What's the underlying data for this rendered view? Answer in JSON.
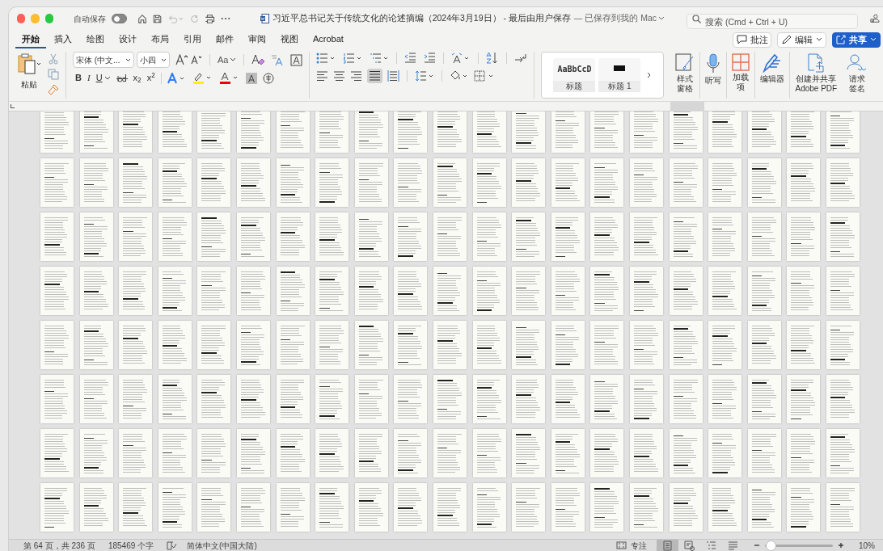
{
  "window": {
    "title": "习近平总书记关于传统文化的论述摘编（2024年3月19日） - 最后由用户保存",
    "save_status": "— 已保存到我的 Mac"
  },
  "autosave": {
    "label": "自动保存",
    "on": false
  },
  "search": {
    "placeholder": "搜索 (Cmd + Ctrl + U)"
  },
  "tabs": [
    {
      "label": "开始",
      "selected": true
    },
    {
      "label": "插入",
      "selected": false
    },
    {
      "label": "绘图",
      "selected": false
    },
    {
      "label": "设计",
      "selected": false
    },
    {
      "label": "布局",
      "selected": false
    },
    {
      "label": "引用",
      "selected": false
    },
    {
      "label": "邮件",
      "selected": false
    },
    {
      "label": "审阅",
      "selected": false
    },
    {
      "label": "视图",
      "selected": false
    },
    {
      "label": "Acrobat",
      "selected": false
    }
  ],
  "header_buttons": [
    {
      "label": "批注",
      "kind": "comment"
    },
    {
      "label": "编辑",
      "kind": "edit"
    },
    {
      "label": "共享",
      "kind": "share"
    }
  ],
  "clipboard": {
    "paste_label": "粘贴"
  },
  "font": {
    "name": "宋体 (中文...",
    "size": "小四",
    "case_label": "Aa"
  },
  "format_buttons": [
    {
      "label": "B",
      "kind": "bold"
    },
    {
      "label": "I",
      "kind": "italic"
    },
    {
      "label": "U",
      "kind": "underline"
    },
    {
      "label": "x$_{2}$",
      "kind": "plain"
    },
    {
      "label": "x$^{2}$",
      "kind": "plain"
    }
  ],
  "styles": [
    {
      "preview": "AaBbCcD",
      "label": "标题",
      "kind": "text"
    },
    {
      "label": "标题 1",
      "kind": "blob"
    }
  ],
  "large_buttons": [
    {
      "label": "样式窗格",
      "kind": "styles-pane"
    },
    {
      "label": "听写",
      "kind": "mic"
    },
    {
      "label": "加载项",
      "kind": "addins"
    },
    {
      "label": "编辑器",
      "kind": "editor"
    },
    {
      "label": "创建并共享\nAdobe PDF",
      "kind": "pdf"
    },
    {
      "label": "请求签名",
      "kind": "sign"
    }
  ],
  "status_bar": {
    "page": "第 64 页，共 236 页",
    "words": "185469 个字",
    "language": "简体中文(中国大陆)",
    "focus": "专注",
    "zoom": "10%",
    "zoom_level": {
      "level": 0.08
    },
    "views": [
      {
        "kind": "print",
        "selected": true
      },
      {
        "kind": "web",
        "selected": false
      },
      {
        "kind": "outline",
        "selected": false
      },
      {
        "kind": "draft",
        "selected": false
      }
    ]
  }
}
